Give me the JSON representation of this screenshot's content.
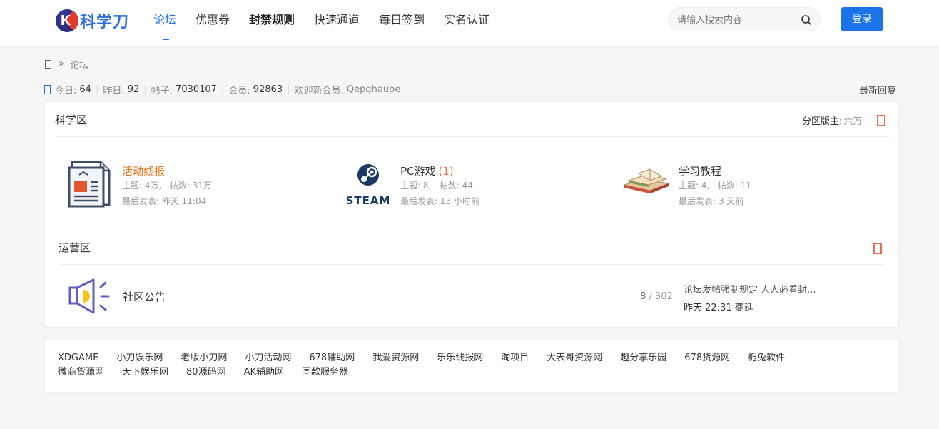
{
  "header": {
    "logo_text": "科学刀",
    "nav": [
      {
        "label": "论坛",
        "active": true
      },
      {
        "label": "优惠券"
      },
      {
        "label": "封禁规则",
        "bold": true
      },
      {
        "label": "快速通道"
      },
      {
        "label": "每日签到"
      },
      {
        "label": "实名认证"
      }
    ],
    "search_placeholder": "请输入搜索内容",
    "login_label": "登录"
  },
  "breadcrumb": {
    "separator": "»",
    "current": "论坛"
  },
  "stats": {
    "today_label": "今日:",
    "today": "64",
    "yesterday_label": "昨日:",
    "yesterday": "92",
    "posts_label": "帖子:",
    "posts": "7030107",
    "members_label": "会员:",
    "members": "92863",
    "welcome_label": "欢迎新会员:",
    "newest_member": "Qepghaupe",
    "latest_reply": "最新回复"
  },
  "sections": {
    "science": {
      "title": "科学区",
      "moderator_label": "分区版主:",
      "moderator": "六万",
      "forums": [
        {
          "name": "活动线报",
          "threads": "主题: 4万,",
          "posts": "帖数: 31万",
          "last": "最后发表: 昨天 11:04",
          "icon": "newspaper-icon"
        },
        {
          "name": "PC游戏",
          "new_count": "(1)",
          "threads": "主题: 8,",
          "posts": "帖数: 44",
          "last": "最后发表: 13 小时前",
          "icon": "steam-logo-icon"
        },
        {
          "name": "学习教程",
          "threads": "主题: 4,",
          "posts": "帖数: 11",
          "last": "最后发表: 3 天前",
          "icon": "books-icon"
        }
      ]
    },
    "operations": {
      "title": "运营区",
      "forum": {
        "name": "社区公告",
        "threads": "8",
        "posts": "/ 302",
        "last_title": "论坛发帖强制规定 人人必看封...",
        "last_time": "昨天 22:31 夔延"
      }
    }
  },
  "links": [
    [
      "XDGAME",
      "小刀娱乐网",
      "老版小刀网",
      "小刀活动网",
      "678辅助网",
      "我爱资源网",
      "乐乐线报网",
      "淘项目",
      "大表哥资源网",
      "趣分享乐园",
      "678货源网",
      "栀兔软件"
    ],
    [
      "微商货源网",
      "天下娱乐网",
      "80源码网",
      "AK辅助网",
      "同款服务器"
    ]
  ],
  "colors": {
    "accent": "#1a73e8",
    "orange": "#e8741e",
    "red": "#f06b4f"
  }
}
